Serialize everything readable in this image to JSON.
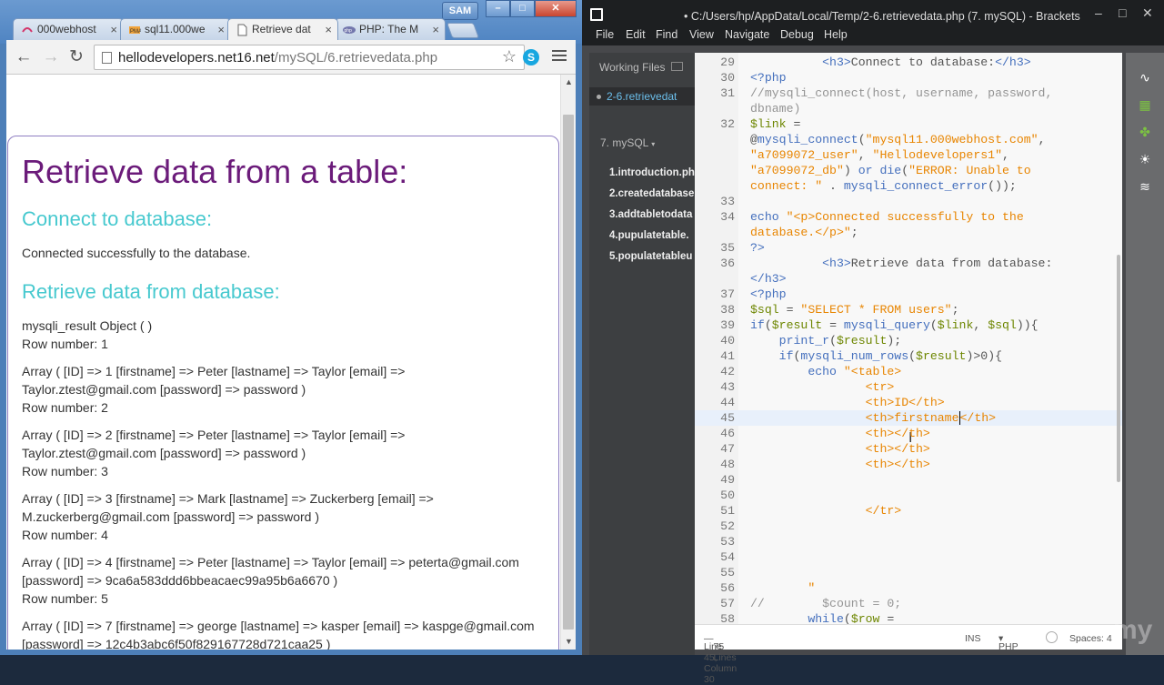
{
  "chrome": {
    "user_badge": "SAM",
    "tabs": [
      {
        "label": "000webhost",
        "icon": "webhost-favicon",
        "active": false
      },
      {
        "label": "sql11.000we",
        "icon": "phpmyadmin-favicon",
        "active": false
      },
      {
        "label": "Retrieve dat",
        "icon": "page-favicon",
        "active": true
      },
      {
        "label": "PHP: The M",
        "icon": "php-favicon",
        "active": false
      }
    ],
    "url_host": "hellodevelopers.net16.net",
    "url_path": "/mySQL/6.retrievedata.php",
    "page": {
      "title": "Retrieve data from a table:",
      "h_connect": "Connect to database:",
      "connected_msg": "Connected successfully to the database.",
      "h_retrieve": "Retrieve data from database:",
      "result_object": "mysqli_result Object ( )",
      "row_label_1": "Row number: 1",
      "rows": [
        {
          "line1": "Array ( [ID] => 1 [firstname] => Peter [lastname] => Taylor [email] =>",
          "line2": "Taylor.ztest@gmail.com [password] => password )",
          "row": "Row number: 2"
        },
        {
          "line1": "Array ( [ID] => 2 [firstname] => Peter [lastname] => Taylor [email] =>",
          "line2": "Taylor.ztest@gmail.com [password] => password )",
          "row": "Row number: 3"
        },
        {
          "line1": "Array ( [ID] => 3 [firstname] => Mark [lastname] => Zuckerberg [email] =>",
          "line2": "M.zuckerberg@gmail.com [password] => password )",
          "row": "Row number: 4"
        },
        {
          "line1": "Array ( [ID] => 4 [firstname] => Peter [lastname] => Taylor [email] => peterta@gmail.com",
          "line2": "[password] => 9ca6a583ddd6bbeacaec99a95b6a6670 )",
          "row": "Row number: 5"
        },
        {
          "line1": "Array ( [ID] => 7 [firstname] => george [lastname] => kasper [email] => kaspge@gmail.com",
          "line2": "[password] => 12c4b3abc6f50f829167728d721caa25 )",
          "row": ""
        }
      ]
    }
  },
  "brackets": {
    "title": "• C:/Users/hp/AppData/Local/Temp/2-6.retrievedata.php (7. mySQL) - Brackets",
    "menu": [
      "File",
      "Edit",
      "Find",
      "View",
      "Navigate",
      "Debug",
      "Help"
    ],
    "working_files_label": "Working Files",
    "active_file": "2-6.retrievedat",
    "project": "7. mySQL",
    "tree": [
      "1.introduction.php",
      "2.createdatabase",
      "3.addtabletodata",
      "4.pupulatetable.",
      "5.populatetableu"
    ],
    "status": {
      "position": "Line 45, Column 30",
      "lines": "75 Lines",
      "ins": "INS",
      "lang": "PHP",
      "spaces": "Spaces: 4"
    },
    "code": [
      {
        "n": "29",
        "html": "          <span class='t'>&lt;h3&gt;</span>Connect to database:<span class='t'>&lt;/h3&gt;</span>"
      },
      {
        "n": "30",
        "html": "<span class='k'>&lt;?php</span>"
      },
      {
        "n": "31",
        "html": "<span class='c'>//mysqli_connect(host, username, password,</span>"
      },
      {
        "n": "",
        "html": "<span class='c'>dbname)</span>"
      },
      {
        "n": "32",
        "html": "<span class='v'>$link</span> ="
      },
      {
        "n": "",
        "html": "@<span class='k'>mysqli_connect</span>(<span class='s'>\"mysql11.000webhost.com\"</span>,"
      },
      {
        "n": "",
        "html": "<span class='s'>\"a7099072_user\"</span>, <span class='s'>\"Hellodevelopers1\"</span>,"
      },
      {
        "n": "",
        "html": "<span class='s'>\"a7099072_db\"</span>) <span class='k'>or</span> <span class='k'>die</span>(<span class='s'>\"ERROR: Unable to</span>"
      },
      {
        "n": "",
        "html": "<span class='s'>connect: \"</span> . <span class='k'>mysqli_connect_error</span>());"
      },
      {
        "n": "33",
        "html": ""
      },
      {
        "n": "34",
        "html": "<span class='k'>echo</span> <span class='s'>\"&lt;p&gt;Connected successfully to the</span>"
      },
      {
        "n": "",
        "html": "<span class='s'>database.&lt;/p&gt;\"</span>;"
      },
      {
        "n": "35",
        "html": "<span class='k'>?&gt;</span>"
      },
      {
        "n": "36",
        "html": "          <span class='t'>&lt;h3&gt;</span>Retrieve data from database:"
      },
      {
        "n": "",
        "html": "<span class='t'>&lt;/h3&gt;</span>"
      },
      {
        "n": "37",
        "html": "<span class='k'>&lt;?php</span>"
      },
      {
        "n": "38",
        "html": "<span class='v'>$sql</span> = <span class='s'>\"SELECT * FROM users\"</span>;"
      },
      {
        "n": "39",
        "html": "<span class='k'>if</span>(<span class='v'>$result</span> = <span class='k'>mysqli_query</span>(<span class='v'>$link</span>, <span class='v'>$sql</span>)){"
      },
      {
        "n": "40",
        "html": "    <span class='k'>print_r</span>(<span class='v'>$result</span>);"
      },
      {
        "n": "41",
        "html": "    <span class='k'>if</span>(<span class='k'>mysqli_num_rows</span>(<span class='v'>$result</span>)&gt;0){"
      },
      {
        "n": "42",
        "html": "        <span class='k'>echo</span> <span class='s'>\"&lt;table&gt;</span>"
      },
      {
        "n": "43",
        "html": "                <span class='s'>&lt;tr&gt;</span>"
      },
      {
        "n": "44",
        "html": "                <span class='s'>&lt;th&gt;ID&lt;/th&gt;</span>"
      },
      {
        "n": "45",
        "html": "                <span class='s'>&lt;th&gt;firstname</span><span class='cursor'></span><span class='s'>&lt;/th&gt;</span>",
        "hl": true
      },
      {
        "n": "46",
        "html": "                <span class='s'>&lt;th&gt;&lt;/th&gt;</span>"
      },
      {
        "n": "47",
        "html": "                <span class='s'>&lt;th&gt;&lt;/th&gt;</span>"
      },
      {
        "n": "48",
        "html": "                <span class='s'>&lt;th&gt;&lt;/th&gt;</span>"
      },
      {
        "n": "49",
        "html": ""
      },
      {
        "n": "50",
        "html": ""
      },
      {
        "n": "51",
        "html": "                <span class='s'>&lt;/tr&gt;</span>"
      },
      {
        "n": "52",
        "html": ""
      },
      {
        "n": "53",
        "html": ""
      },
      {
        "n": "54",
        "html": ""
      },
      {
        "n": "55",
        "html": ""
      },
      {
        "n": "56",
        "html": "        <span class='s'>\"</span>"
      },
      {
        "n": "57",
        "html": "<span class='c'>//        $count = 0;</span>"
      },
      {
        "n": "58",
        "html": "        <span class='k'>while</span>(<span class='v'>$row</span> ="
      }
    ]
  },
  "colors": {
    "page_title": "#6b1b7a",
    "page_heading": "#47c9cf",
    "code_string": "#e88501",
    "code_keyword": "#446fbd",
    "code_variable": "#6d8600"
  }
}
